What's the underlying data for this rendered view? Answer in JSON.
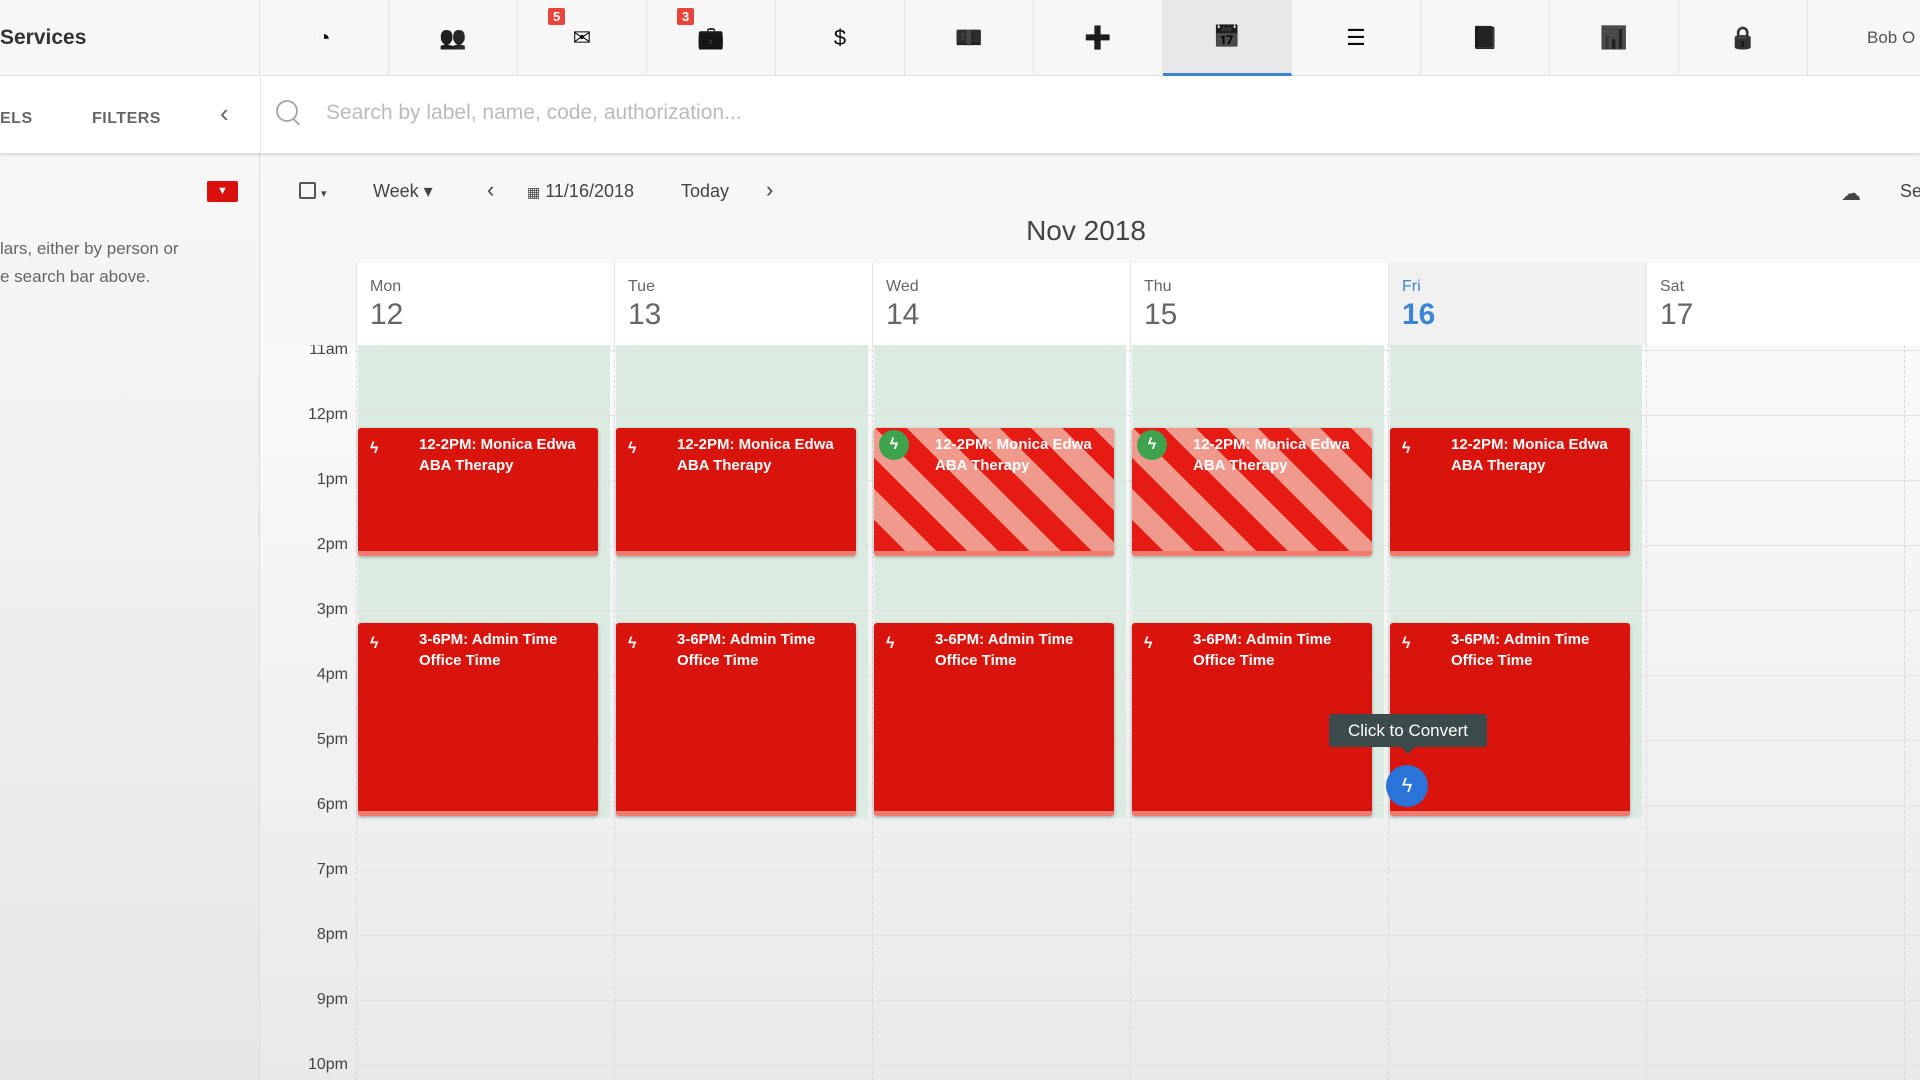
{
  "app": {
    "title": "Services",
    "user": "Bob O"
  },
  "nav": [
    {
      "icon": "dashboard-icon",
      "glyph": "◔"
    },
    {
      "icon": "users-icon",
      "glyph": "👥"
    },
    {
      "icon": "mail-icon",
      "glyph": "✉",
      "badge": "5"
    },
    {
      "icon": "briefcase-icon",
      "glyph": "💼",
      "badge": "3"
    },
    {
      "icon": "dollar-icon",
      "glyph": "$"
    },
    {
      "icon": "payroll-icon",
      "glyph": "💵"
    },
    {
      "icon": "medical-plus-icon",
      "glyph": "➕"
    },
    {
      "icon": "calendar-icon",
      "glyph": "📅",
      "active": true
    },
    {
      "icon": "checklist-icon",
      "glyph": "☰"
    },
    {
      "icon": "book-icon",
      "glyph": "📘"
    },
    {
      "icon": "bar-chart-icon",
      "glyph": "📊"
    },
    {
      "icon": "lock-icon",
      "glyph": "🔒"
    }
  ],
  "sidebar": {
    "tabs": [
      "ELS",
      "FILTERS"
    ],
    "help_line1": "lars, either by person or",
    "help_line2": "e search bar above."
  },
  "search": {
    "placeholder": "Search by label, name, code, authorization...",
    "value": ""
  },
  "toolbar": {
    "view": "Week ▾",
    "date": "11/16/2018",
    "today": "Today",
    "right_label": "Se"
  },
  "calendar": {
    "month": "Nov 2018",
    "days": [
      {
        "name": "Mon",
        "num": "12"
      },
      {
        "name": "Tue",
        "num": "13"
      },
      {
        "name": "Wed",
        "num": "14"
      },
      {
        "name": "Thu",
        "num": "15"
      },
      {
        "name": "Fri",
        "num": "16",
        "today": true
      },
      {
        "name": "Sat",
        "num": "17"
      }
    ],
    "hours": [
      "11am",
      "12pm",
      "1pm",
      "2pm",
      "3pm",
      "4pm",
      "5pm",
      "6pm",
      "7pm",
      "8pm",
      "9pm",
      "10pm"
    ],
    "events": [
      {
        "day": 0,
        "start": 12,
        "end": 14,
        "title": "12-2PM: Monica Edwa",
        "subtitle": "ABA Therapy"
      },
      {
        "day": 1,
        "start": 12,
        "end": 14,
        "title": "12-2PM: Monica Edwa",
        "subtitle": "ABA Therapy"
      },
      {
        "day": 2,
        "start": 12,
        "end": 14,
        "title": "12-2PM: Monica Edwa",
        "subtitle": "ABA Therapy",
        "striped": true,
        "converted": true
      },
      {
        "day": 3,
        "start": 12,
        "end": 14,
        "title": "12-2PM: Monica Edwa",
        "subtitle": "ABA Therapy",
        "striped": true,
        "converted": true
      },
      {
        "day": 4,
        "start": 12,
        "end": 14,
        "title": "12-2PM: Monica Edwa",
        "subtitle": "ABA Therapy"
      },
      {
        "day": 0,
        "start": 15,
        "end": 18,
        "title": "3-6PM: Admin Time",
        "subtitle": "Office Time"
      },
      {
        "day": 1,
        "start": 15,
        "end": 18,
        "title": "3-6PM: Admin Time",
        "subtitle": "Office Time"
      },
      {
        "day": 2,
        "start": 15,
        "end": 18,
        "title": "3-6PM: Admin Time",
        "subtitle": "Office Time"
      },
      {
        "day": 3,
        "start": 15,
        "end": 18,
        "title": "3-6PM: Admin Time",
        "subtitle": "Office Time"
      },
      {
        "day": 4,
        "start": 15,
        "end": 18,
        "title": "3-6PM: Admin Time",
        "subtitle": "Office Time"
      }
    ],
    "tooltip": "Click to Convert"
  },
  "colors": {
    "event": "#d9140d",
    "accent": "#3a86d4",
    "converted": "#3fa34d",
    "convert_button": "#2a73d8"
  }
}
